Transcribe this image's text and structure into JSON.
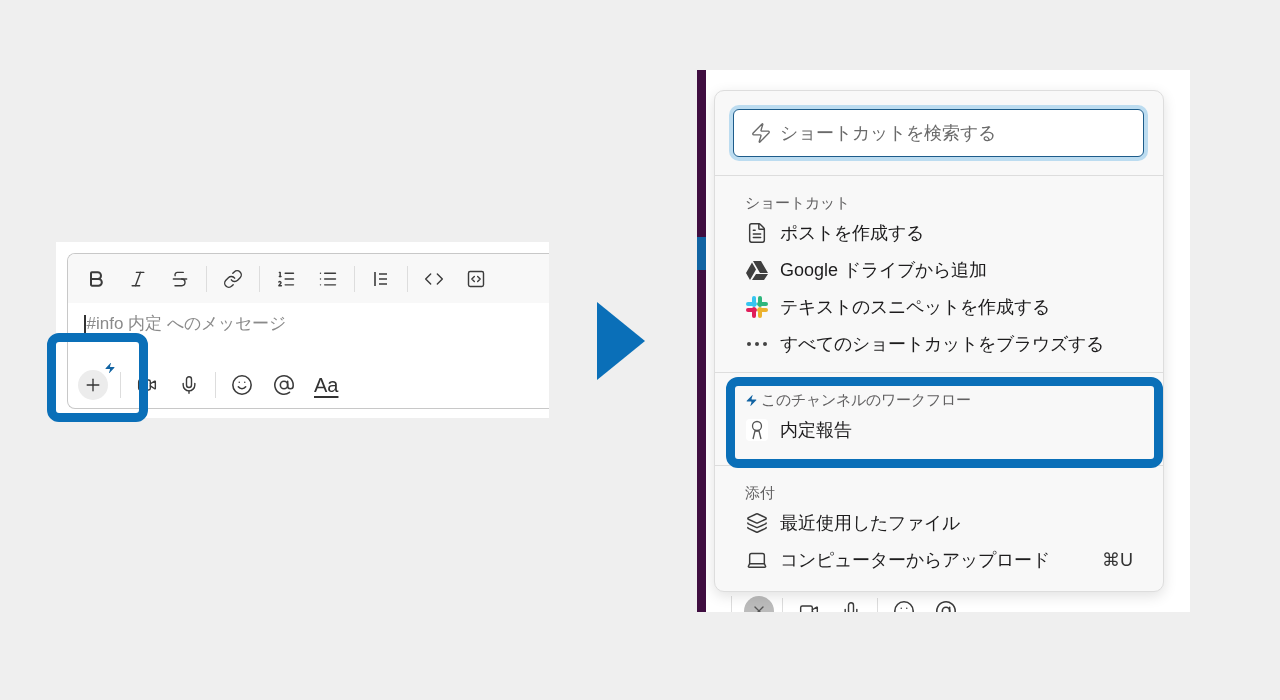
{
  "composer": {
    "format_tools": [
      {
        "kind": "bold"
      },
      {
        "kind": "italic"
      },
      {
        "kind": "strike"
      },
      {
        "kind": "separator"
      },
      {
        "kind": "link"
      },
      {
        "kind": "separator"
      },
      {
        "kind": "ordered"
      },
      {
        "kind": "bullet"
      },
      {
        "kind": "separator"
      },
      {
        "kind": "quote"
      },
      {
        "kind": "separator"
      },
      {
        "kind": "code"
      },
      {
        "kind": "codeblock"
      }
    ],
    "placeholder": "#info 内定 へのメッセージ",
    "actions": [
      {
        "kind": "plus"
      },
      {
        "kind": "separator"
      },
      {
        "kind": "video"
      },
      {
        "kind": "mic"
      },
      {
        "kind": "separator"
      },
      {
        "kind": "emoji"
      },
      {
        "kind": "mention"
      },
      {
        "kind": "format",
        "label": "Aa"
      }
    ]
  },
  "shortcut_menu": {
    "search": {
      "placeholder": "ショートカットを検索する"
    },
    "sections": [
      {
        "title": "ショートカット",
        "workflow": false,
        "items": [
          {
            "kind": "document",
            "label": "ポストを作成する"
          },
          {
            "kind": "drive",
            "label": "Google ドライブから追加"
          },
          {
            "kind": "slack",
            "label": "テキストのスニペットを作成する"
          },
          {
            "kind": "dots",
            "label": "すべてのショートカットをブラウズする"
          }
        ]
      },
      {
        "title": "このチャンネルのワークフロー",
        "workflow": true,
        "items": [
          {
            "kind": "figure",
            "label": "内定報告"
          }
        ]
      },
      {
        "title": "添付",
        "workflow": false,
        "items": [
          {
            "kind": "layers",
            "label": "最近使用したファイル"
          },
          {
            "kind": "laptop",
            "label": "コンピューターからアップロード",
            "shortcut": "⌘U"
          }
        ]
      }
    ]
  },
  "bottom_actions": [
    {
      "kind": "close"
    },
    {
      "kind": "separator"
    },
    {
      "kind": "video"
    },
    {
      "kind": "mic"
    },
    {
      "kind": "separator"
    },
    {
      "kind": "emoji"
    },
    {
      "kind": "mention"
    }
  ]
}
